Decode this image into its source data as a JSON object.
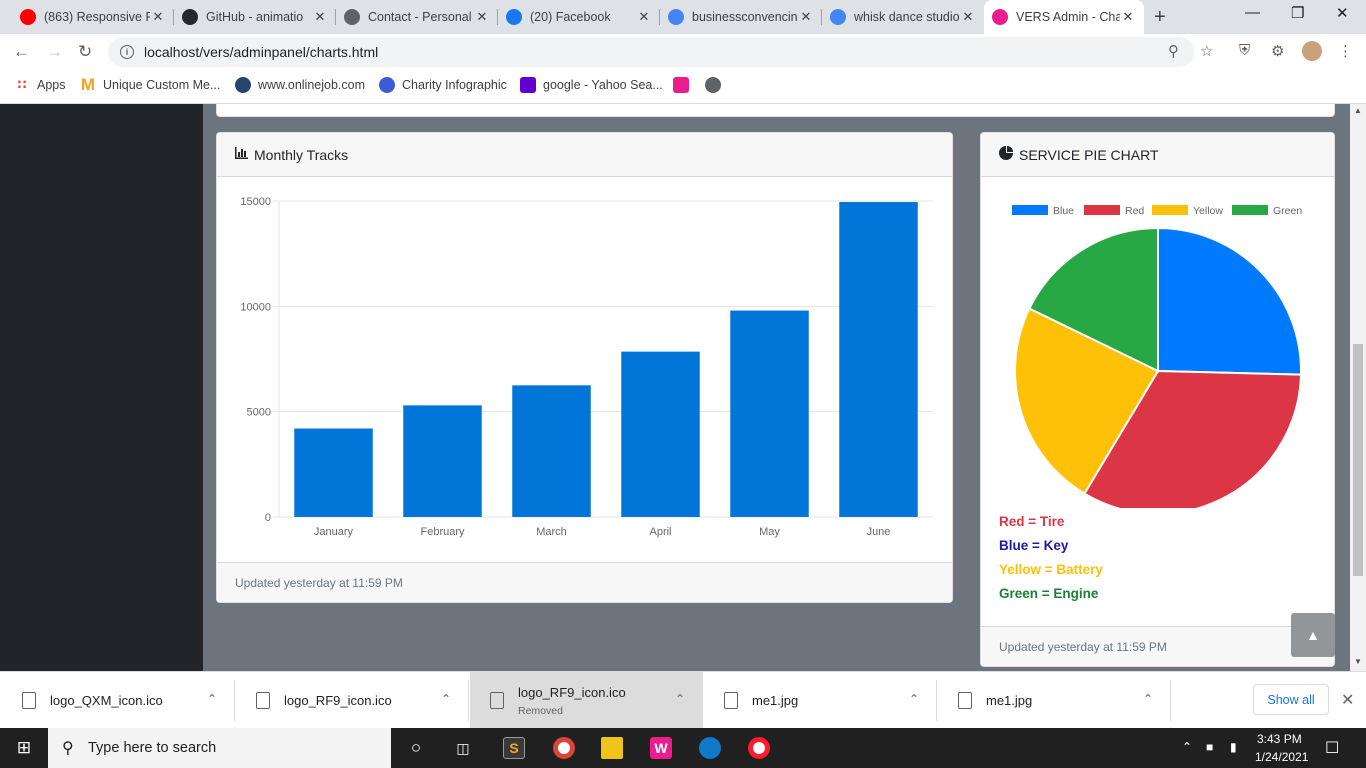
{
  "browser": {
    "tabs": [
      {
        "title": "(863) Responsive P",
        "icon": "youtube-icon",
        "color": "#ff0000",
        "active": false
      },
      {
        "title": "GitHub - animatio",
        "icon": "github-icon",
        "color": "#24292e",
        "active": false
      },
      {
        "title": "Contact - Personal",
        "icon": "globe-icon",
        "color": "#5f6368",
        "active": false
      },
      {
        "title": "(20) Facebook",
        "icon": "facebook-icon",
        "color": "#1877f2",
        "active": false
      },
      {
        "title": "businessconvencin",
        "icon": "google-icon",
        "color": "#4285f4",
        "active": false
      },
      {
        "title": "whisk dance studio",
        "icon": "google-icon",
        "color": "#4285f4",
        "active": false
      },
      {
        "title": "VERS Admin - Cha",
        "icon": "vers-icon",
        "color": "#e91e8c",
        "active": true
      }
    ],
    "url": "localhost/vers/adminpanel/charts.html",
    "bookmarks": [
      {
        "label": "Apps",
        "icon": "apps-grid-icon"
      },
      {
        "label": "Unique Custom Me...",
        "icon": "m-logo-icon"
      },
      {
        "label": "www.onlinejob.com",
        "icon": "onlinejob-icon"
      },
      {
        "label": "Charity Infographic",
        "icon": "canva-icon"
      },
      {
        "label": "google - Yahoo Sea...",
        "icon": "yahoo-icon"
      },
      {
        "label": "",
        "icon": "vers-icon"
      },
      {
        "label": "",
        "icon": "globe-icon"
      }
    ]
  },
  "monthly_card": {
    "title": "Monthly Tracks",
    "icon": "bar-chart-icon",
    "footer": "Updated yesterday at 11:59 PM"
  },
  "pie_card": {
    "title": "SERVICE PIE CHART",
    "icon": "pie-chart-icon",
    "footer": "Updated yesterday at 11:59 PM",
    "legend_text": [
      {
        "text": "Red = Tire",
        "color": "#dc3545"
      },
      {
        "text": "Blue = Key",
        "color": "#1a1aa8"
      },
      {
        "text": "Yellow = Battery",
        "color": "#ffc107"
      },
      {
        "text": "Green = Engine",
        "color": "#1e7e34"
      }
    ]
  },
  "chart_data": [
    {
      "type": "bar",
      "categories": [
        "January",
        "February",
        "March",
        "April",
        "May",
        "June"
      ],
      "values": [
        4200,
        5300,
        6250,
        7850,
        9800,
        14950
      ],
      "ylim": [
        0,
        15000
      ],
      "yticks": [
        "0",
        "5000",
        "10000",
        "15000"
      ],
      "color": "#0275d8",
      "grid": true
    },
    {
      "type": "pie",
      "labels": [
        "Blue",
        "Red",
        "Yellow",
        "Green"
      ],
      "values": [
        25.4,
        33.2,
        23.6,
        17.8
      ],
      "colors": [
        "#007bff",
        "#dc3545",
        "#ffc107",
        "#28a745"
      ],
      "legend_position": "top"
    }
  ],
  "downloads": {
    "items": [
      {
        "name": "logo_QXM_icon.ico",
        "status": ""
      },
      {
        "name": "logo_RF9_icon.ico",
        "status": ""
      },
      {
        "name": "logo_RF9_icon.ico",
        "status": "Removed"
      },
      {
        "name": "me1.jpg",
        "status": ""
      },
      {
        "name": "me1.jpg",
        "status": ""
      }
    ],
    "show_all": "Show all"
  },
  "taskbar": {
    "search_placeholder": "Type here to search",
    "time": "3:43 PM",
    "date": "1/24/2021"
  }
}
